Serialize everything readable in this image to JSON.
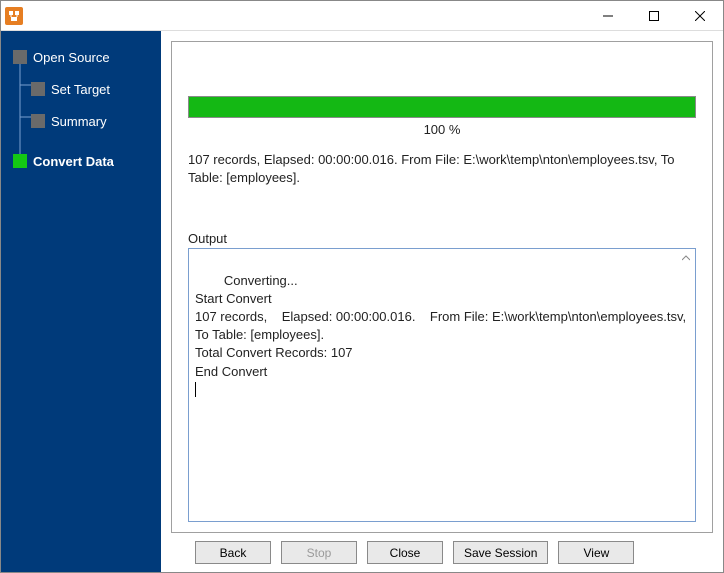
{
  "titlebar": {
    "app_icon": "app-icon"
  },
  "sidebar": {
    "items": [
      {
        "label": "Open Source",
        "active": false,
        "root": true
      },
      {
        "label": "Set Target",
        "active": false,
        "root": false
      },
      {
        "label": "Summary",
        "active": false,
        "root": false
      },
      {
        "label": "Convert Data",
        "active": true,
        "root": false
      }
    ]
  },
  "progress": {
    "percent_text": "100 %",
    "percent_value": 100
  },
  "status_text": "107 records,    Elapsed: 00:00:00.016.    From File: E:\\work\\temp\\nton\\employees.tsv,    To Table: [employees].",
  "output": {
    "label": "Output",
    "text": "Converting...\nStart Convert\n107 records,    Elapsed: 00:00:00.016.    From File: E:\\work\\temp\\nton\\employees.tsv,    To Table: [employees].\nTotal Convert Records: 107\nEnd Convert"
  },
  "buttons": {
    "back": "Back",
    "stop": "Stop",
    "close": "Close",
    "save_session": "Save Session",
    "view": "View"
  }
}
